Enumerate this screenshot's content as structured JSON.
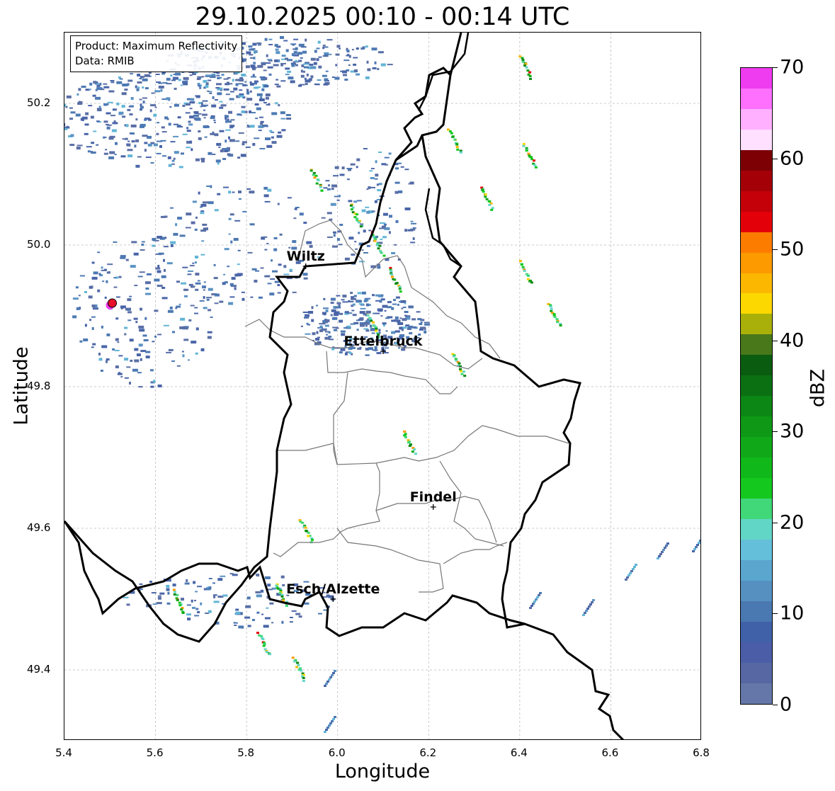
{
  "title": "29.10.2025 00:10 - 00:14 UTC",
  "info": {
    "product": "Product: Maximum Reflectivity",
    "data": "Data: RMIB"
  },
  "axes": {
    "xlabel": "Longitude",
    "ylabel": "Latitude",
    "xlim": [
      5.4,
      6.8
    ],
    "ylim": [
      49.3,
      50.3
    ],
    "xticks": [
      "5.4",
      "5.6",
      "5.8",
      "6.0",
      "6.2",
      "6.4",
      "6.6",
      "6.8"
    ],
    "yticks": [
      "49.4",
      "49.6",
      "49.8",
      "50.0",
      "50.2"
    ]
  },
  "cities": [
    {
      "name": "Wiltz",
      "lon": 5.93,
      "lat": 49.97
    },
    {
      "name": "Ettelbruck",
      "lon": 6.1,
      "lat": 49.85
    },
    {
      "name": "Findel",
      "lon": 6.21,
      "lat": 49.63
    },
    {
      "name": "Esch/Alzette",
      "lon": 5.99,
      "lat": 49.5
    }
  ],
  "radar_marker": {
    "lon": 5.505,
    "lat": 49.918,
    "color": "#e8102a"
  },
  "colorbar": {
    "label": "dBZ",
    "min": 0,
    "max": 70,
    "ticks": [
      "0",
      "10",
      "20",
      "30",
      "40",
      "50",
      "60",
      "70"
    ],
    "colors": [
      "#6577a8",
      "#5667a4",
      "#4b5da6",
      "#4060a8",
      "#4a78b0",
      "#5590c0",
      "#5aa6cf",
      "#64bfdb",
      "#62d6c6",
      "#40d878",
      "#14c81e",
      "#10b81a",
      "#10a818",
      "#0e9816",
      "#0c8614",
      "#0a7012",
      "#0a5c10",
      "#48781a",
      "#aab00a",
      "#fdd800",
      "#fcb800",
      "#fc9a00",
      "#fc7c00",
      "#e40008",
      "#c40008",
      "#a40008",
      "#7c0004",
      "#ffe0ff",
      "#ffb0ff",
      "#ff70ff",
      "#f03cf0"
    ]
  }
}
